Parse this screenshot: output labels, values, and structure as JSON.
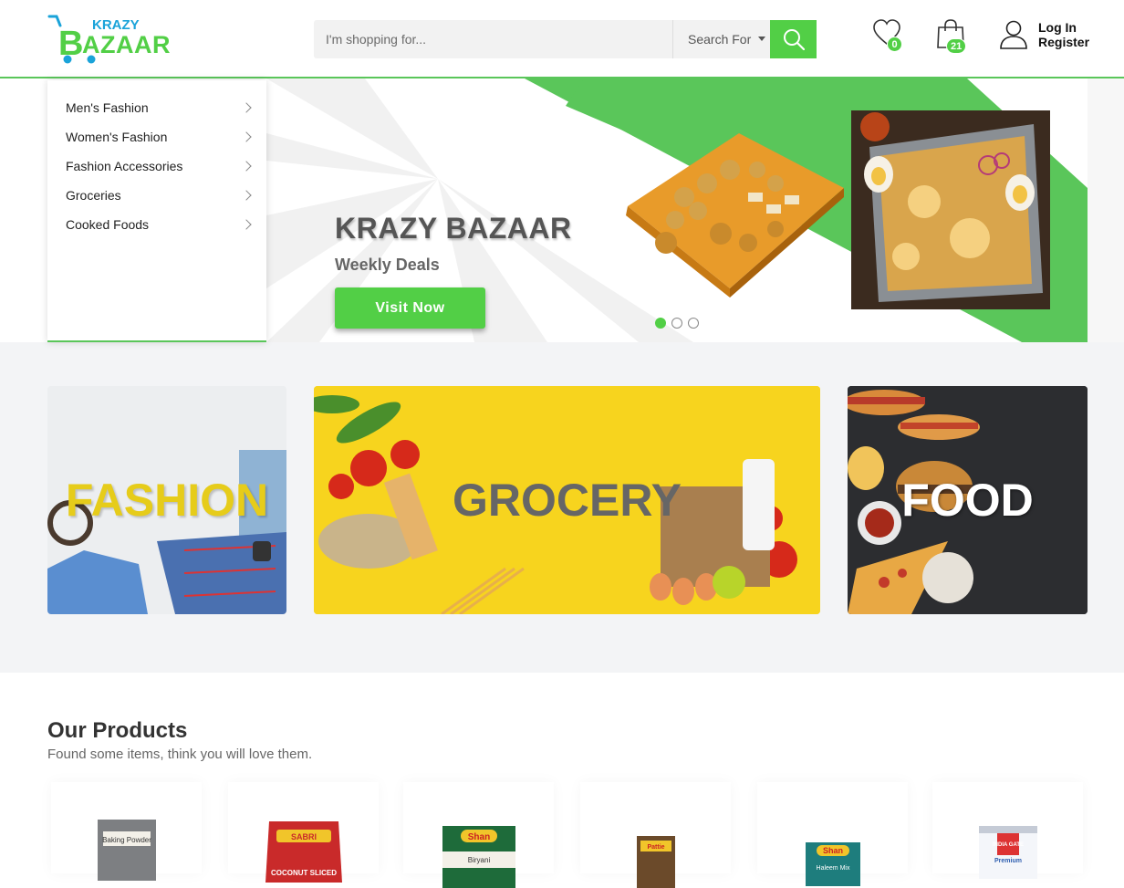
{
  "header": {
    "logo_top": "KRAZY",
    "logo_bottom": "BAZAAR",
    "search_placeholder": "I'm shopping for...",
    "search_select": "Search For",
    "wishlist_count": "0",
    "cart_count": "21",
    "login": "Log In",
    "register": "Register"
  },
  "sidebar": {
    "items": [
      {
        "label": "Men's Fashion"
      },
      {
        "label": "Women's Fashion"
      },
      {
        "label": "Fashion Accessories"
      },
      {
        "label": "Groceries"
      },
      {
        "label": "Cooked Foods"
      }
    ]
  },
  "hero": {
    "title": "KRAZY BAZAAR",
    "subtitle": "Weekly Deals",
    "button": "Visit Now",
    "slides": 3,
    "active_slide": 1
  },
  "banners": [
    {
      "label": "FASHION",
      "color": "#e6cc1a"
    },
    {
      "label": "GROCERY",
      "color": "#666666"
    },
    {
      "label": "FOOD",
      "color": "#ffffff"
    }
  ],
  "products": {
    "title": "Our Products",
    "subtitle": "Found some items, think you will love them.",
    "items": [
      {
        "brand": "",
        "name": "Baking Powder",
        "color": "#8a8a8a"
      },
      {
        "brand": "SABRI",
        "name": "COCONUT SLICED",
        "color": "#c92a2a"
      },
      {
        "brand": "Shan",
        "name": "Biryani",
        "color": "#1e6b3a"
      },
      {
        "brand": "Pattie",
        "name": "",
        "color": "#6b4a2a"
      },
      {
        "brand": "Shan",
        "name": "Haleem Mix",
        "color": "#1e7d7d"
      },
      {
        "brand": "INDIA GATE",
        "name": "Premium",
        "color": "#2f5fb0"
      }
    ]
  },
  "colors": {
    "accent": "#52cf46",
    "accent_line": "#5ac65a",
    "banner_bg": "#f3f4f6"
  }
}
